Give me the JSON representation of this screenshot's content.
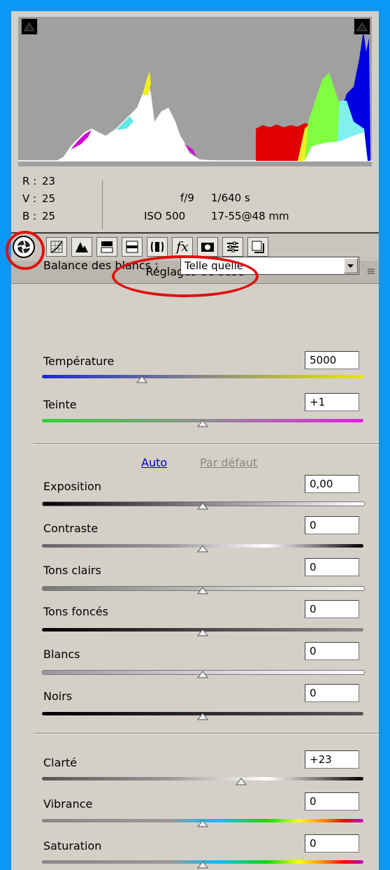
{
  "histogram": {
    "channels": [
      "red",
      "green",
      "blue"
    ],
    "clipping_shadow_icon": "triangle-icon",
    "clipping_highlight_icon": "triangle-icon"
  },
  "readout": {
    "r_label": "R :",
    "r_value": "23",
    "v_label": "V :",
    "v_value": "25",
    "b_label": "B :",
    "b_value": "25",
    "aperture": "f/9",
    "shutter": "1/640 s",
    "iso": "ISO 500",
    "lens": "17-55@48 mm"
  },
  "toolbar": {
    "tools": [
      "basic-icon",
      "tone-curve-icon",
      "detail-icon",
      "hsl-icon",
      "split-toning-icon",
      "lens-icon",
      "fx-icon",
      "camera-calibration-icon",
      "presets-icon",
      "snapshots-icon"
    ]
  },
  "panel": {
    "title": "Réglages de base"
  },
  "white_balance": {
    "label": "Balance des blancs :",
    "value": "Telle quelle"
  },
  "temperature": {
    "label": "Température",
    "value": "5000",
    "level": 0.31
  },
  "tint": {
    "label": "Teinte",
    "value": "+1",
    "level": 0.5
  },
  "auto_label": "Auto",
  "default_label": "Par défaut",
  "exposure": {
    "label": "Exposition",
    "value": "0,00",
    "level": 0.5
  },
  "contrast": {
    "label": "Contraste",
    "value": "0",
    "level": 0.5
  },
  "highlights": {
    "label": "Tons clairs",
    "value": "0",
    "level": 0.5
  },
  "shadows": {
    "label": "Tons foncés",
    "value": "0",
    "level": 0.5
  },
  "whites": {
    "label": "Blancs",
    "value": "0",
    "level": 0.5
  },
  "blacks": {
    "label": "Noirs",
    "value": "0",
    "level": 0.5
  },
  "clarity": {
    "label": "Clarté",
    "value": "+23",
    "level": 0.62
  },
  "vibrance": {
    "label": "Vibrance",
    "value": "0",
    "level": 0.5
  },
  "saturation": {
    "label": "Saturation",
    "value": "0",
    "level": 0.5
  },
  "colors": {
    "link": "#0000cc",
    "link_disabled": "#8a8780",
    "annotation": "#e01010",
    "background": "#0a97f5"
  }
}
